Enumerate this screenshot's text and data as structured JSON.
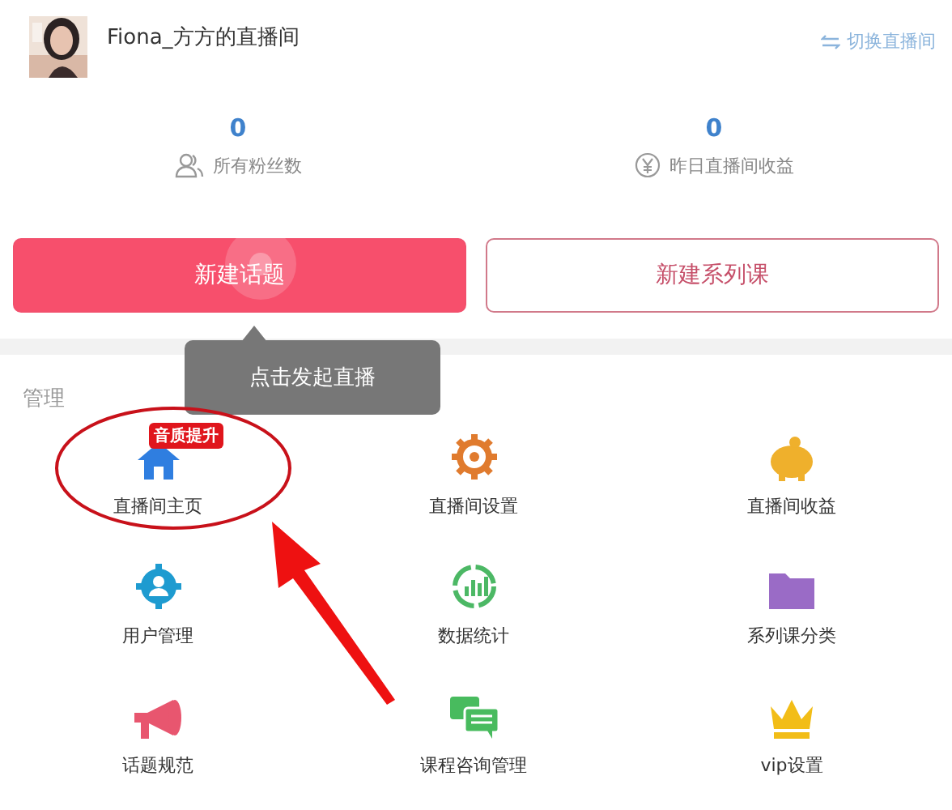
{
  "header": {
    "room_name": "Fiona_方方的直播间",
    "switch_link": "切换直播间"
  },
  "stats": [
    {
      "value": "0",
      "label": "所有粉丝数"
    },
    {
      "value": "0",
      "label": "昨日直播间收益"
    }
  ],
  "buttons": [
    {
      "label": "新建话题",
      "kind": "primary"
    },
    {
      "label": "新建系列课",
      "kind": "outline"
    }
  ],
  "tooltip": "点击发起直播",
  "section_title": "管理",
  "grid": [
    {
      "label": "直播间主页",
      "badge": "音质提升"
    },
    {
      "label": "直播间设置"
    },
    {
      "label": "直播间收益"
    },
    {
      "label": "用户管理"
    },
    {
      "label": "数据统计"
    },
    {
      "label": "系列课分类"
    },
    {
      "label": "话题规范"
    },
    {
      "label": "课程咨询管理"
    },
    {
      "label": "vip设置"
    }
  ]
}
